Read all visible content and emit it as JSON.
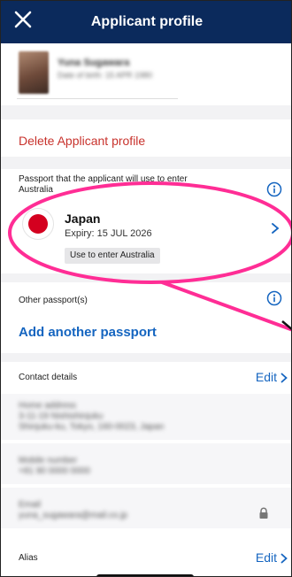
{
  "header": {
    "title": "Applicant profile",
    "close_icon": "close-icon"
  },
  "profile": {
    "name": "Yuna Sugawara",
    "dob": "Date of birth: 15 APR 1980"
  },
  "delete_label": "Delete Applicant profile",
  "passport": {
    "section_label": "Passport that the applicant will use to enter Australia",
    "country": "Japan",
    "expiry": "Expiry: 15 JUL 2026",
    "badge": "Use to enter Australia",
    "flag_color": "#d4001f"
  },
  "other_passports": {
    "label": "Other passport(s)",
    "add_label": "Add another passport"
  },
  "contact": {
    "label": "Contact details",
    "edit_label": "Edit",
    "address": {
      "label": "Home address",
      "line1": "3-11-19 Nishishinjuku",
      "line2": "Shinjuku-ku, Tokyo, 160-0023, Japan"
    },
    "mobile": {
      "label": "Mobile number",
      "value": "+81 90 0000 0000"
    },
    "email": {
      "label": "Email",
      "value": "yuna_sugawara@mail.co.jp"
    }
  },
  "alias": {
    "label": "Alias",
    "edit_label": "Edit"
  },
  "colors": {
    "header_bg": "#0b2a5c",
    "link_blue": "#1565c0",
    "danger_red": "#c8322c",
    "annotation_pink": "#ff2d95"
  }
}
